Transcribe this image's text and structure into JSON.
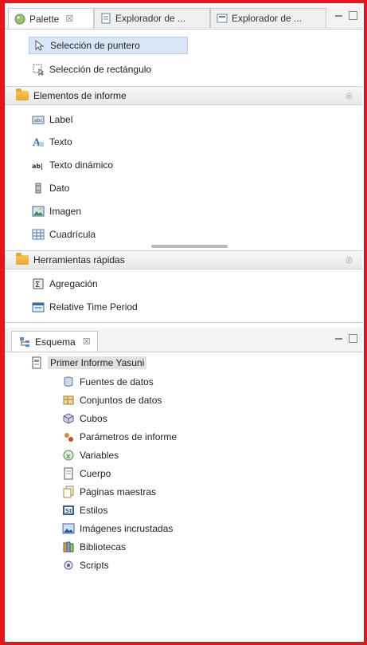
{
  "palette_tabs": [
    {
      "label": "Palette",
      "close": "☒",
      "active": true
    },
    {
      "label": "Explorador de ...",
      "active": false
    },
    {
      "label": "Explorador de ...",
      "active": false
    }
  ],
  "palette_tools": [
    {
      "label": "Selección de puntero",
      "icon": "pointer-arrow-icon",
      "selected": true
    },
    {
      "label": "Selección de rectángulo",
      "icon": "marquee-select-icon",
      "selected": false
    }
  ],
  "report_elements": {
    "header": "Elementos de informe",
    "items": [
      {
        "label": "Label",
        "icon": "label-icon"
      },
      {
        "label": "Texto",
        "icon": "text-icon"
      },
      {
        "label": "Texto dinámico",
        "icon": "dynamic-text-icon"
      },
      {
        "label": "Dato",
        "icon": "data-icon"
      },
      {
        "label": "Imagen",
        "icon": "image-icon"
      },
      {
        "label": "Cuadrícula",
        "icon": "grid-icon"
      }
    ]
  },
  "quick_tools": {
    "header": "Herramientas rápidas",
    "items": [
      {
        "label": "Agregación",
        "icon": "aggregation-icon"
      },
      {
        "label": "Relative Time Period",
        "icon": "relative-time-icon"
      }
    ]
  },
  "outline": {
    "tab_label": "Esquema",
    "tab_close": "☒",
    "root": "Primer Informe Yasuni",
    "children": [
      {
        "label": "Fuentes de datos",
        "icon": "data-sources-icon"
      },
      {
        "label": "Conjuntos de datos",
        "icon": "data-sets-icon"
      },
      {
        "label": "Cubos",
        "icon": "cubes-icon"
      },
      {
        "label": "Parámetros de informe",
        "icon": "report-parameters-icon"
      },
      {
        "label": "Variables",
        "icon": "variables-icon"
      },
      {
        "label": "Cuerpo",
        "icon": "body-icon"
      },
      {
        "label": "Páginas maestras",
        "icon": "master-pages-icon"
      },
      {
        "label": "Estilos",
        "icon": "styles-icon"
      },
      {
        "label": "Imágenes incrustadas",
        "icon": "embedded-images-icon"
      },
      {
        "label": "Bibliotecas",
        "icon": "libraries-icon"
      },
      {
        "label": "Scripts",
        "icon": "scripts-icon"
      }
    ]
  },
  "colors": {
    "frame_border": "#e8141b",
    "selection": "#d8e6f7",
    "folder": "#e9a62c"
  }
}
